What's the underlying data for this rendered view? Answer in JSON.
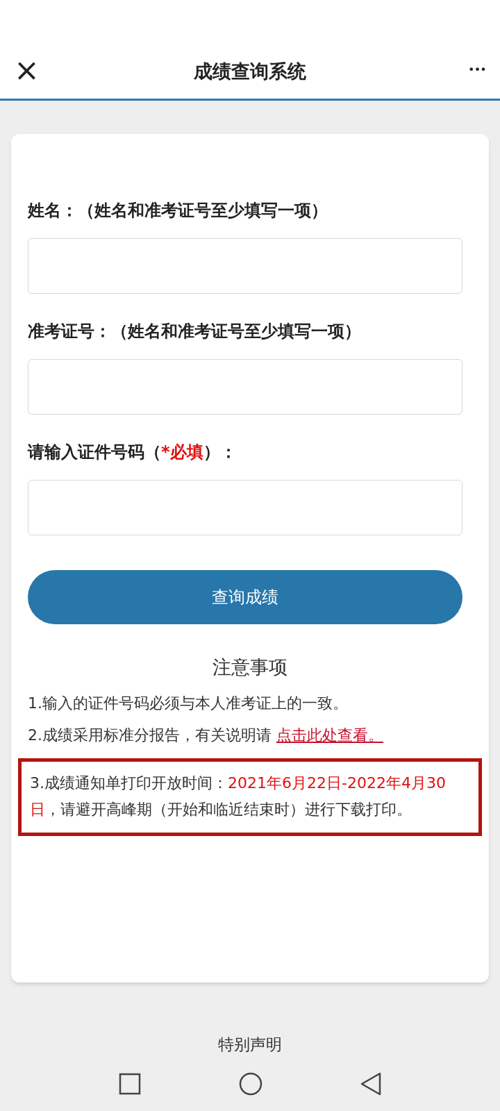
{
  "header": {
    "title": "成绩查询系统",
    "close": "×",
    "more": "•••"
  },
  "form": {
    "fields": [
      {
        "label": [
          {
            "text": "姓名：（姓名和准考证号至少填写一项）",
            "kind": "plain"
          }
        ]
      },
      {
        "label": [
          {
            "text": "准考证号：（姓名和准考证号至少填写一项）",
            "kind": "plain"
          }
        ]
      },
      {
        "label": [
          {
            "text": "请输入证件号码（",
            "kind": "plain"
          },
          {
            "text": "*必填",
            "kind": "required"
          },
          {
            "text": "）：",
            "kind": "plain"
          }
        ]
      }
    ],
    "button": "查询成绩"
  },
  "notes": {
    "title": "注意事项",
    "items": [
      {
        "highlighted": false,
        "segments": [
          {
            "text": "1.输入的证件号码必须与本人准考证上的一致。",
            "kind": "plain"
          }
        ]
      },
      {
        "highlighted": false,
        "segments": [
          {
            "text": "2.成绩采用标准分报告，有关说明请 ",
            "kind": "plain"
          },
          {
            "text": "点击此处查看。",
            "kind": "link"
          }
        ]
      },
      {
        "highlighted": true,
        "segments": [
          {
            "text": "3.成绩通知单打印开放时间：",
            "kind": "plain"
          },
          {
            "text": "2021年6月22日-2022年4月30日",
            "kind": "emphasis"
          },
          {
            "text": "，请避开高峰期（开始和临近结束时）进行下载打印。",
            "kind": "plain"
          }
        ]
      }
    ]
  },
  "footer": {
    "link": "特别声明"
  }
}
